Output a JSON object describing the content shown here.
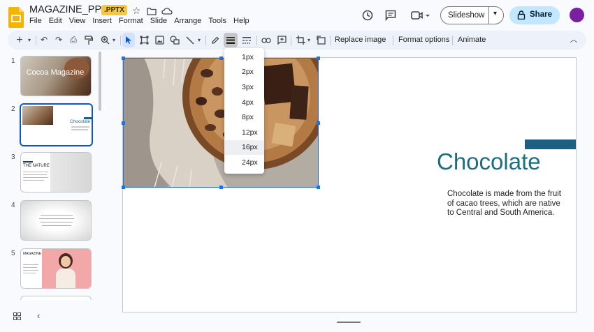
{
  "header": {
    "title": "MAGAZINE_PPTX",
    "badge": ".PPTX",
    "menu": [
      "File",
      "Edit",
      "View",
      "Insert",
      "Format",
      "Slide",
      "Arrange",
      "Tools",
      "Help"
    ],
    "slideshow_label": "Slideshow",
    "share_label": "Share"
  },
  "toolbar": {
    "replace_image": "Replace image",
    "format_options": "Format options",
    "animate": "Animate"
  },
  "filmstrip": {
    "slides": [
      {
        "number": "1",
        "title": "Cocoa Magazine"
      },
      {
        "number": "2",
        "title": "Chocolate"
      },
      {
        "number": "3",
        "title": "THE NATURE"
      },
      {
        "number": "4",
        "title": ""
      },
      {
        "number": "5",
        "title": "MAGAZINE"
      }
    ],
    "selected": "2"
  },
  "slide": {
    "title": "Chocolate",
    "body": "Chocolate is made from the fruit of cacao trees, which are native to Central and South America.",
    "colors": {
      "title": "#1e6e82",
      "accent_bar": "#1e5f80"
    }
  },
  "border_weight_menu": {
    "options": [
      "1px",
      "2px",
      "3px",
      "4px",
      "8px",
      "12px",
      "16px",
      "24px"
    ],
    "highlighted": "16px"
  },
  "colors": {
    "accent": "#0b57d0",
    "share_bg": "#c2e7ff",
    "avatar": "#7b1fa2"
  }
}
